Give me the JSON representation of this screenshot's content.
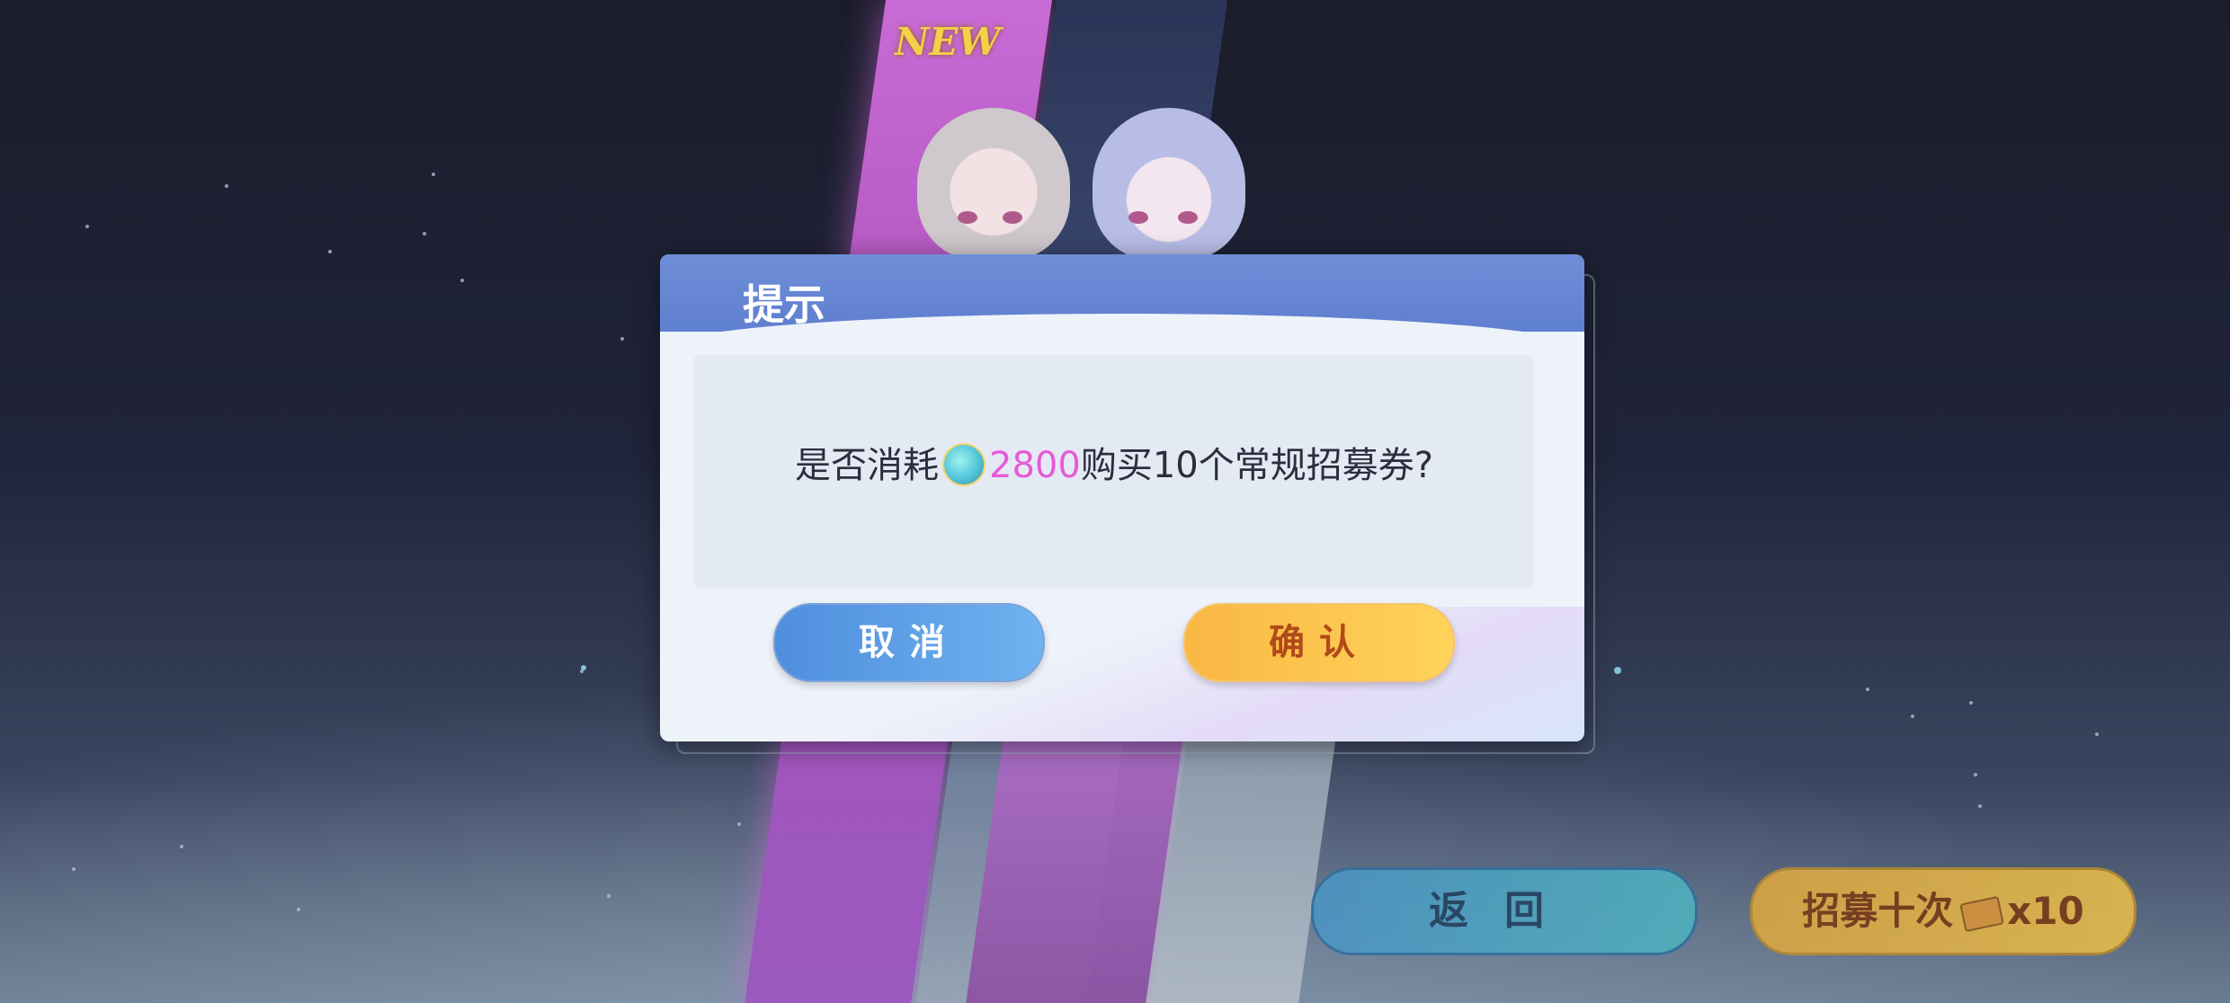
{
  "banner": {
    "new_tag": "NEW"
  },
  "dialog": {
    "title": "提示",
    "message_prefix": "是否消耗",
    "currency_icon": "gem-coin-icon",
    "amount": "2800",
    "message_suffix": "购买10个常规招募券?",
    "cancel_label": "取消",
    "confirm_label": "确认"
  },
  "bottom": {
    "back_label": "返回",
    "recruit_label": "招募十次",
    "ticket_icon": "recruit-ticket-icon",
    "recruit_count": "x10"
  },
  "colors": {
    "amount": "#e65ad8",
    "dialog_header": "#6f8ed9",
    "cancel": "#4f8ede",
    "confirm": "#f9b743"
  }
}
